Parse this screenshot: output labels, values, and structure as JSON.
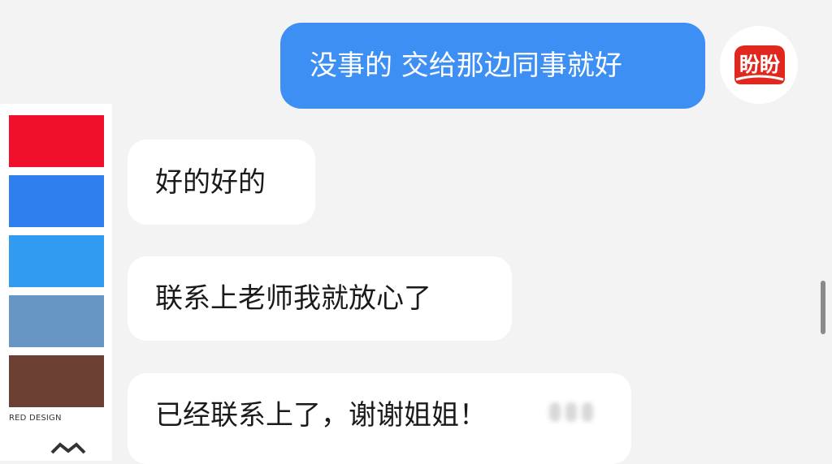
{
  "messages": [
    {
      "direction": "sent",
      "text": "没事的 交给那边同事就好"
    },
    {
      "direction": "received",
      "text": "好的好的"
    },
    {
      "direction": "received",
      "text": "联系上老师我就放心了"
    },
    {
      "direction": "received",
      "text": "已经联系上了，谢谢姐姐！"
    }
  ],
  "avatar": {
    "logo_text": "盼盼",
    "icon": "brand-logo-icon",
    "color": "#e0281e"
  },
  "palette": {
    "label": "RED DESIGN",
    "swatches": [
      "#f0102b",
      "#2f80ee",
      "#319af1",
      "#6795c4",
      "#6b4033"
    ]
  },
  "colors": {
    "sent_bubble": "#3d8ff4",
    "received_bubble": "#ffffff",
    "background": "#f3f3f3"
  }
}
